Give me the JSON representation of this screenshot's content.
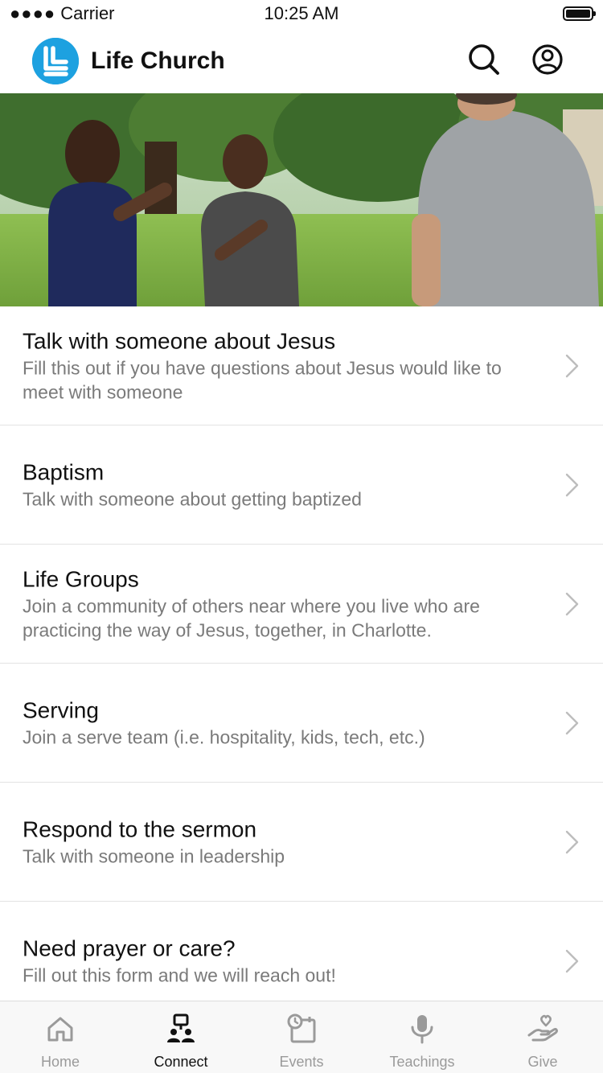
{
  "status_bar": {
    "carrier": "Carrier",
    "time": "10:25 AM"
  },
  "header": {
    "title": "Life Church",
    "brand_color": "#1da1e0",
    "icons": [
      "search-icon",
      "account-icon"
    ]
  },
  "hero": {
    "image": "group-of-men-talking-outdoors"
  },
  "connect_items": [
    {
      "title": "Talk with someone about Jesus",
      "description": "Fill this out if you have questions about Jesus would like to meet with someone"
    },
    {
      "title": "Baptism",
      "description": "Talk with someone about getting baptized"
    },
    {
      "title": "Life Groups",
      "description": "Join a community of others near where you live who are practicing the way of Jesus, together, in Charlotte."
    },
    {
      "title": "Serving",
      "description": "Join a serve team (i.e. hospitality, kids, tech, etc.)"
    },
    {
      "title": "Respond to the sermon",
      "description": "Talk with someone in leadership"
    },
    {
      "title": "Need prayer or care?",
      "description": "Fill out this form and we will reach out!"
    }
  ],
  "tab_bar": {
    "active": "Connect",
    "tabs": [
      {
        "label": "Home",
        "icon": "home-icon"
      },
      {
        "label": "Connect",
        "icon": "connect-icon"
      },
      {
        "label": "Events",
        "icon": "calendar-icon"
      },
      {
        "label": "Teachings",
        "icon": "microphone-icon"
      },
      {
        "label": "Give",
        "icon": "give-icon"
      }
    ]
  }
}
